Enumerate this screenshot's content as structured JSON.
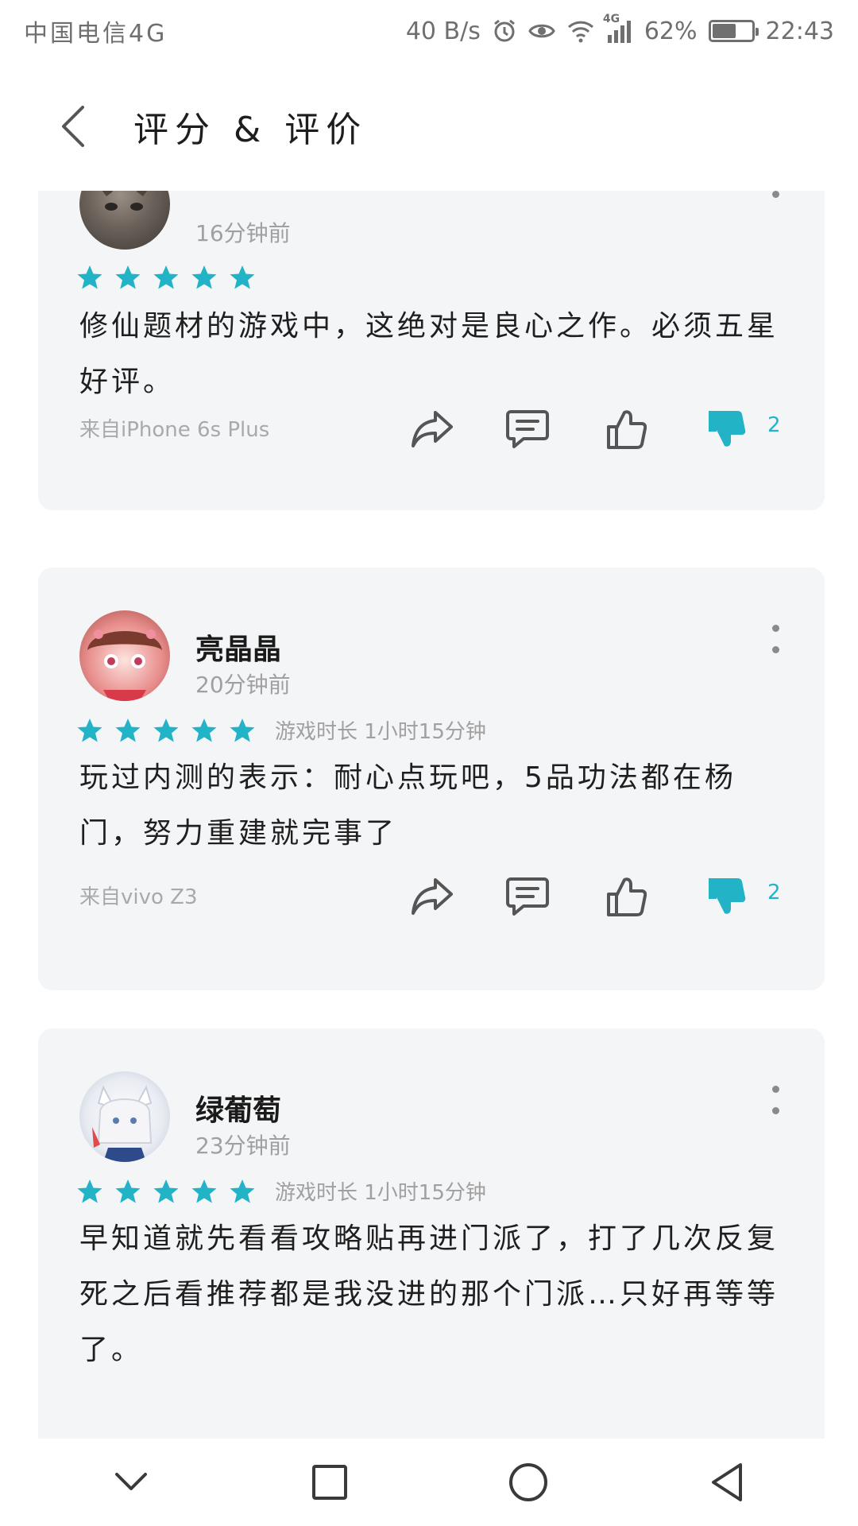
{
  "status_bar": {
    "carrier": "中国电信4G",
    "speed": "40 B/s",
    "network_badge": "4G",
    "battery_text": "62%",
    "battery_level": 0.62,
    "time": "22:43"
  },
  "header": {
    "title": "评分 & 评价"
  },
  "colors": {
    "accent": "#22b4c6",
    "card_bg": "#f4f5f7",
    "muted_text": "#a0a0a0"
  },
  "reviews": [
    {
      "username": "",
      "time": "16分钟前",
      "rating": 5,
      "playtime": "",
      "text": "修仙题材的游戏中，这绝对是良心之作。必须五星好评。",
      "device": "来自iPhone 6s Plus",
      "dislike_count": "2"
    },
    {
      "username": "亮晶晶",
      "time": "20分钟前",
      "rating": 5,
      "playtime": "游戏时长 1小时15分钟",
      "text": "玩过内测的表示：耐心点玩吧，5品功法都在杨门，努力重建就完事了",
      "device": "来自vivo Z3",
      "dislike_count": "2"
    },
    {
      "username": "绿葡萄",
      "time": "23分钟前",
      "rating": 5,
      "playtime": "游戏时长 1小时15分钟",
      "text": "早知道就先看看攻略贴再进门派了，打了几次反复死之后看推荐都是我没进的那个门派…只好再等等了。",
      "device": "",
      "dislike_count": ""
    }
  ],
  "icons": {
    "back": "chevron-left-icon",
    "more": "more-vertical-icon",
    "share": "share-icon",
    "comment": "comment-icon",
    "like": "thumbs-up-icon",
    "dislike": "thumbs-down-icon",
    "nav_collapse": "chevron-down-icon",
    "nav_recents": "square-icon",
    "nav_home": "circle-icon",
    "nav_back": "triangle-back-icon"
  }
}
